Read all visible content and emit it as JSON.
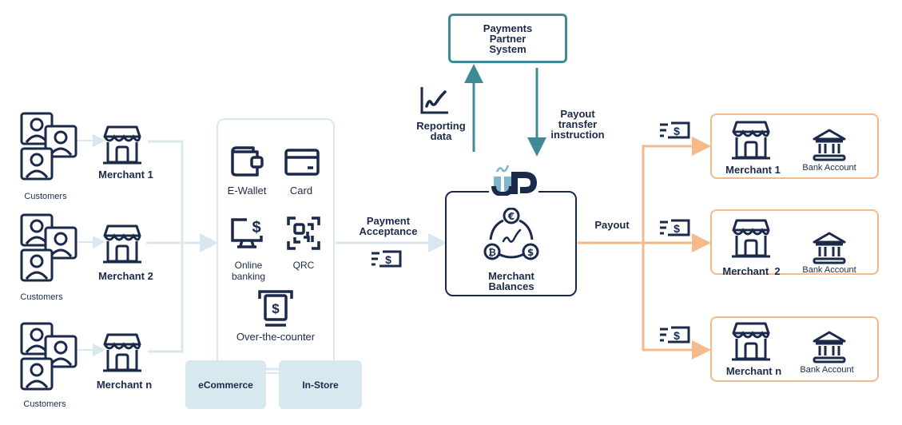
{
  "colors": {
    "navy": "#1b2a4a",
    "light_flow": "#d8e8ee",
    "teal": "#3e8a96",
    "payout_orange": "#f5b98a",
    "logo_light_blue": "#7fb6c9"
  },
  "customers": [
    {
      "label": "Customers",
      "icon": "customers-icon"
    },
    {
      "label": "Customers",
      "icon": "customers-icon"
    },
    {
      "label": "Customers",
      "icon": "customers-icon"
    }
  ],
  "merchants_left": [
    {
      "label": "Merchant 1",
      "icon": "store-icon"
    },
    {
      "label": "Merchant 2",
      "icon": "store-icon"
    },
    {
      "label": "Merchant n",
      "icon": "store-icon"
    }
  ],
  "channels": {
    "items": [
      {
        "label": "E-Wallet",
        "icon": "wallet-icon"
      },
      {
        "label": "Card",
        "icon": "card-icon"
      },
      {
        "label": "Online\nbanking",
        "icon": "online-banking-icon"
      },
      {
        "label": "QRC",
        "icon": "qr-code-icon"
      },
      {
        "label": "Over-the-counter",
        "icon": "counter-icon"
      }
    ],
    "tags": [
      "eCommerce",
      "In-Store"
    ]
  },
  "payment_acceptance": {
    "label": "Payment Acceptance",
    "icon": "cash-transfer-icon"
  },
  "partner": {
    "label": "Payments Partner System"
  },
  "reporting": {
    "label": "Reporting data",
    "icon": "line-chart-icon"
  },
  "payout_instruction": {
    "label": "Payout transfer instruction"
  },
  "balances": {
    "label": "Merchant Balances",
    "logo": "uP",
    "icon": "currency-exchange-icon"
  },
  "payout": {
    "label": "Payout"
  },
  "destinations": [
    {
      "merchant": "Merchant 1",
      "account": "Bank Account"
    },
    {
      "merchant": "Merchant  2",
      "account": "Bank Account"
    },
    {
      "merchant": "Merchant n",
      "account": "Bank Account"
    }
  ]
}
